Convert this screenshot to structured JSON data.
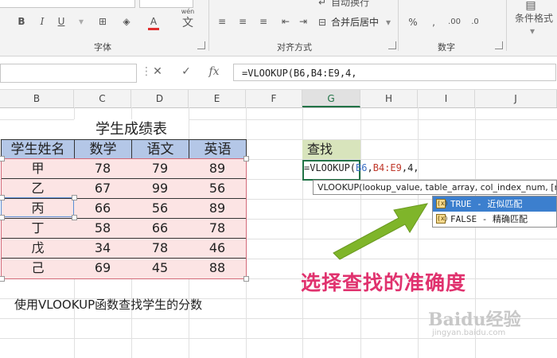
{
  "ribbon": {
    "font_group": "字体",
    "align_group": "对齐方式",
    "number_group": "数字",
    "merge_label": "合并后居中",
    "wrap_label": "自动换行",
    "conditional_format": "条件格式",
    "wen_label": "wén",
    "wen_char": "文",
    "btn_bold": "B",
    "btn_italic": "I",
    "btn_underline": "U",
    "btn_fill": "A",
    "btn_fontcolor": "A"
  },
  "formula_bar": {
    "cancel": "✕",
    "enter": "✓",
    "fx": "fx",
    "value": "=VLOOKUP(B6,B4:E9,4,"
  },
  "columns": [
    "B",
    "C",
    "D",
    "E",
    "F",
    "G",
    "H",
    "I",
    "J"
  ],
  "table": {
    "title": "学生成绩表",
    "headers": [
      "学生姓名",
      "数学",
      "语文",
      "英语"
    ],
    "rows": [
      [
        "甲",
        "78",
        "79",
        "89"
      ],
      [
        "乙",
        "67",
        "99",
        "56"
      ],
      [
        "丙",
        "66",
        "56",
        "89"
      ],
      [
        "丁",
        "58",
        "66",
        "78"
      ],
      [
        "戊",
        "34",
        "78",
        "46"
      ],
      [
        "己",
        "69",
        "45",
        "88"
      ]
    ]
  },
  "lookup": {
    "label": "查找",
    "edit_prefix": "=VLOOKUP(",
    "edit_arg1": "B6",
    "edit_comma1": ",",
    "edit_arg2": "B4:E9",
    "edit_rest": ",4,"
  },
  "tooltip": "VLOOKUP(lookup_value, table_array, col_index_num, [range_lookup])",
  "dropdown": [
    {
      "label": "TRUE - 近似匹配",
      "highlighted": true
    },
    {
      "label": "FALSE - 精确匹配",
      "highlighted": false
    }
  ],
  "dropdown_icon": "(x)",
  "callout": "选择查找的准确度",
  "note": "使用VLOOKUP函数查找学生的分数",
  "watermark": "Baidu经验",
  "watermark_sub": "jingyan.baidu.com",
  "colors": {
    "header_fill": "#b4c7e7",
    "body_fill": "#fce4e4",
    "find_fill": "#d8e4bc",
    "callout": "#e0326e",
    "arrow": "#7fb52a",
    "highlight": "#3c7fce"
  }
}
